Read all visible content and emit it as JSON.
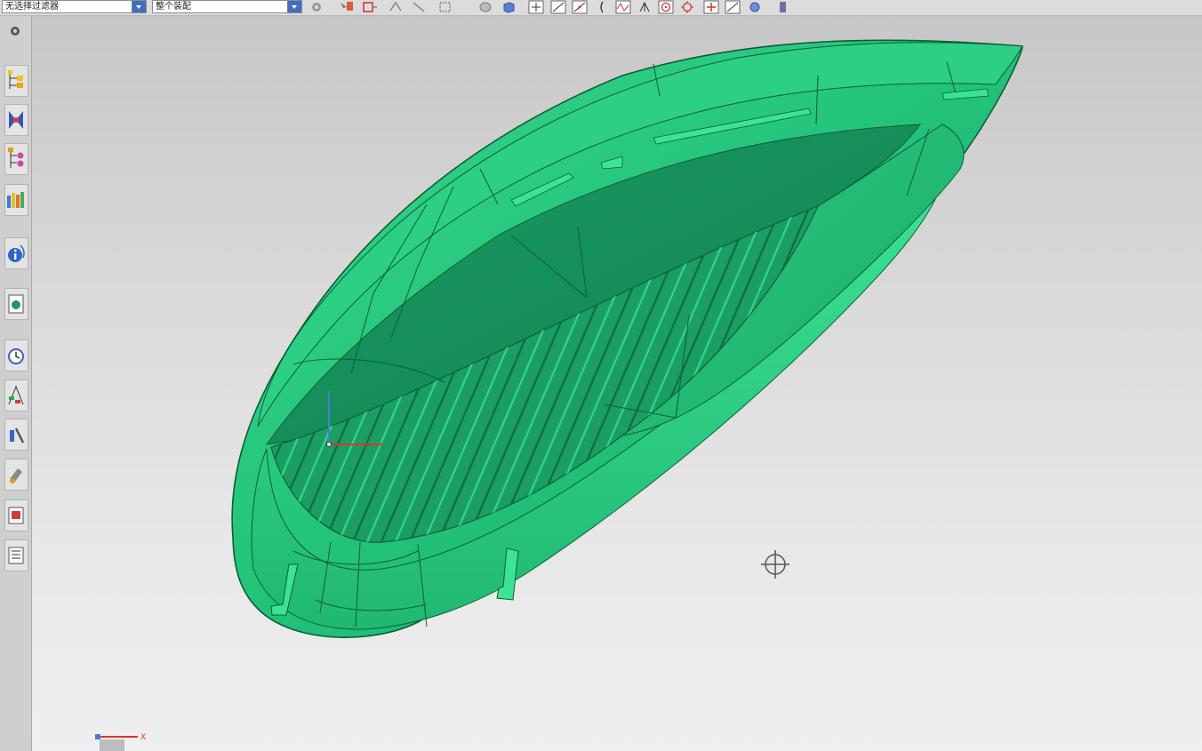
{
  "toolbar": {
    "type_filter": {
      "value": "无选择过滤器"
    },
    "scope_filter": {
      "value": "整个装配"
    },
    "icons": [
      "snap-icon",
      "select-icon",
      "undo-icon",
      "rectangle-select-icon",
      "sphere-icon",
      "cube-icon",
      "snap-endpoint-icon",
      "snap-line-icon",
      "snap-midpoint-icon",
      "snap-arc-icon",
      "snap-curve-icon",
      "snap-intersection-icon",
      "snap-center-icon",
      "snap-quadrant-icon",
      "snap-point-icon",
      "snap-tangent-icon",
      "snap-face-icon",
      "book-icon"
    ]
  },
  "resource_bar": {
    "items": [
      "settings-icon",
      "assembly-navigator-icon",
      "constraint-navigator-icon",
      "part-navigator-icon",
      "reuse-library-icon",
      "info-icon",
      "web-browser-icon",
      "history-icon",
      "process-navigator-icon",
      "roles-icon",
      "system-materials-icon",
      "palette-icon",
      "layers-icon"
    ]
  },
  "viewport": {
    "model_color": "#23c77b",
    "axis_labels": {
      "x": "X"
    }
  }
}
